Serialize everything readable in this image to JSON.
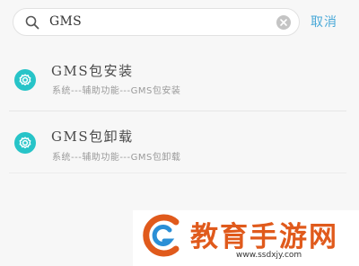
{
  "search": {
    "value": "GMS",
    "icon": "search-icon",
    "clear_icon": "clear-icon",
    "cancel_label": "取消"
  },
  "results": [
    {
      "icon": "settings-gear-icon",
      "title": "GMS包安装",
      "subtitle": "系统---辅助功能---GMS包安装"
    },
    {
      "icon": "settings-gear-icon",
      "title": "GMS包卸载",
      "subtitle": "系统---辅助功能---GMS包卸载"
    }
  ],
  "watermark": {
    "text": "教育手游网",
    "url": "www.ssdxjy.com"
  },
  "colors": {
    "accent": "#4aa9d8",
    "icon_bg": "#27c4c8",
    "watermark": "#e05a1c"
  }
}
